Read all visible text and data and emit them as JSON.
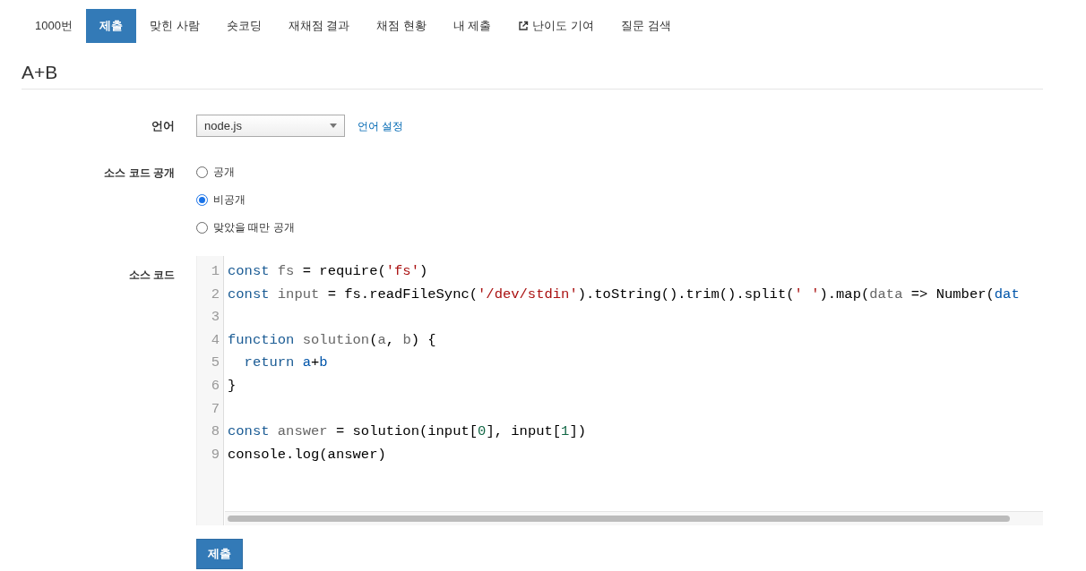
{
  "tabs": [
    {
      "label": "1000번",
      "selected": false,
      "external": false
    },
    {
      "label": "제출",
      "selected": true,
      "external": false
    },
    {
      "label": "맞힌 사람",
      "selected": false,
      "external": false
    },
    {
      "label": "숏코딩",
      "selected": false,
      "external": false
    },
    {
      "label": "재채점 결과",
      "selected": false,
      "external": false
    },
    {
      "label": "채점 현황",
      "selected": false,
      "external": false
    },
    {
      "label": "내 제출",
      "selected": false,
      "external": false
    },
    {
      "label": "난이도 기여",
      "selected": false,
      "external": true
    },
    {
      "label": "질문 검색",
      "selected": false,
      "external": false
    }
  ],
  "title": "A+B",
  "language": {
    "label": "언어",
    "value": "node.js",
    "settings_link": "언어 설정"
  },
  "visibility": {
    "label": "소스 코드 공개",
    "options": [
      {
        "label": "공개",
        "selected": false
      },
      {
        "label": "비공개",
        "selected": true
      },
      {
        "label": "맞았을 때만 공개",
        "selected": false
      }
    ]
  },
  "source": {
    "label": "소스 코드",
    "lines": [
      {
        "number": "1",
        "tokens": [
          {
            "kind": "keyword",
            "text": "const"
          },
          {
            "kind": "def",
            "text": " fs"
          },
          {
            "kind": "plain",
            "text": " = require("
          },
          {
            "kind": "string",
            "text": "'fs'"
          },
          {
            "kind": "plain",
            "text": ")"
          }
        ]
      },
      {
        "number": "2",
        "tokens": [
          {
            "kind": "keyword",
            "text": "const"
          },
          {
            "kind": "def",
            "text": " input"
          },
          {
            "kind": "plain",
            "text": " = fs.readFileSync("
          },
          {
            "kind": "string",
            "text": "'/dev/stdin'"
          },
          {
            "kind": "plain",
            "text": ").toString().trim().split("
          },
          {
            "kind": "string",
            "text": "' '"
          },
          {
            "kind": "plain",
            "text": ").map("
          },
          {
            "kind": "def",
            "text": "data"
          },
          {
            "kind": "plain",
            "text": " => Number("
          },
          {
            "kind": "variable",
            "text": "dat"
          }
        ]
      },
      {
        "number": "3"
      },
      {
        "number": "4",
        "tokens": [
          {
            "kind": "keyword",
            "text": "function"
          },
          {
            "kind": "def",
            "text": " solution"
          },
          {
            "kind": "plain",
            "text": "("
          },
          {
            "kind": "def",
            "text": "a"
          },
          {
            "kind": "plain",
            "text": ", "
          },
          {
            "kind": "def",
            "text": "b"
          },
          {
            "kind": "plain",
            "text": ") {"
          }
        ]
      },
      {
        "number": "5",
        "tokens": [
          {
            "kind": "keyword",
            "text": "  return"
          },
          {
            "kind": "variable",
            "text": " a"
          },
          {
            "kind": "plain",
            "text": "+"
          },
          {
            "kind": "variable",
            "text": "b"
          }
        ]
      },
      {
        "number": "6",
        "tokens": [
          {
            "kind": "plain",
            "text": "}"
          }
        ]
      },
      {
        "number": "7"
      },
      {
        "number": "8",
        "tokens": [
          {
            "kind": "keyword",
            "text": "const"
          },
          {
            "kind": "def",
            "text": " answer"
          },
          {
            "kind": "plain",
            "text": " = solution(input["
          },
          {
            "kind": "number",
            "text": "0"
          },
          {
            "kind": "plain",
            "text": "], input["
          },
          {
            "kind": "number",
            "text": "1"
          },
          {
            "kind": "plain",
            "text": "])"
          }
        ]
      },
      {
        "number": "9",
        "tokens": [
          {
            "kind": "plain",
            "text": "console.log(answer)"
          }
        ]
      }
    ]
  },
  "submit": "제출"
}
